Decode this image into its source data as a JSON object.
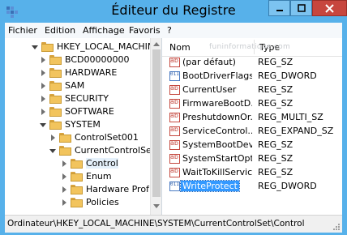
{
  "window": {
    "title": "Éditeur du Registre"
  },
  "menu": [
    "Fichier",
    "Edition",
    "Affichage",
    "Favoris",
    "?"
  ],
  "tree": [
    {
      "label": "HKEY_LOCAL_MACHINE",
      "state": "expanded"
    },
    {
      "label": "BCD00000000",
      "state": "collapsed"
    },
    {
      "label": "HARDWARE",
      "state": "collapsed"
    },
    {
      "label": "SAM",
      "state": "collapsed"
    },
    {
      "label": "SECURITY",
      "state": "collapsed"
    },
    {
      "label": "SOFTWARE",
      "state": "collapsed"
    },
    {
      "label": "SYSTEM",
      "state": "expanded"
    },
    {
      "label": "ControlSet001",
      "state": "collapsed"
    },
    {
      "label": "CurrentControlSet",
      "state": "expanded"
    },
    {
      "label": "Control",
      "state": "collapsed",
      "selected": true
    },
    {
      "label": "Enum",
      "state": "collapsed"
    },
    {
      "label": "Hardware Prof",
      "state": "collapsed"
    },
    {
      "label": "Policies",
      "state": "collapsed"
    }
  ],
  "list": {
    "columns": {
      "name": "Nom",
      "type": "Type"
    },
    "watermark": "funinformatique.com",
    "rows": [
      {
        "name": "(par défaut)",
        "type": "REG_SZ",
        "icon": "string-value-icon"
      },
      {
        "name": "BootDriverFlags",
        "type": "REG_DWORD",
        "icon": "binary-value-icon"
      },
      {
        "name": "CurrentUser",
        "type": "REG_SZ",
        "icon": "string-value-icon"
      },
      {
        "name": "FirmwareBootD...",
        "type": "REG_SZ",
        "icon": "string-value-icon"
      },
      {
        "name": "PreshutdownOr...",
        "type": "REG_MULTI_SZ",
        "icon": "string-value-icon"
      },
      {
        "name": "ServiceControl...",
        "type": "REG_EXPAND_SZ",
        "icon": "string-value-icon"
      },
      {
        "name": "SystemBootDevi...",
        "type": "REG_SZ",
        "icon": "string-value-icon"
      },
      {
        "name": "SystemStartOpti...",
        "type": "REG_SZ",
        "icon": "string-value-icon"
      },
      {
        "name": "WaitToKillServic...",
        "type": "REG_SZ",
        "icon": "string-value-icon"
      },
      {
        "name": "WriteProtect",
        "type": "REG_DWORD",
        "icon": "binary-value-icon",
        "selected": true
      }
    ]
  },
  "status": "Ordinateur\\HKEY_LOCAL_MACHINE\\SYSTEM\\CurrentControlSet\\Control",
  "colors": {
    "titlebar": "#57b1ea",
    "close": "#c7463e",
    "selection": "#3399ff"
  }
}
